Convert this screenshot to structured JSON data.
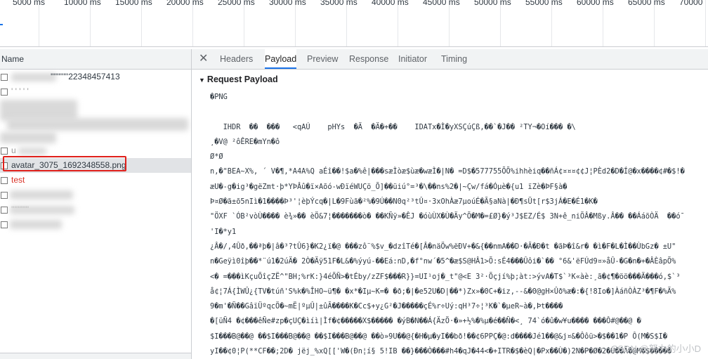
{
  "timeline": {
    "ticks": [
      "5000 ms",
      "10000 ms",
      "15000 ms",
      "20000 ms",
      "25000 ms",
      "30000 ms",
      "35000 ms",
      "40000 ms",
      "45000 ms",
      "50000 ms",
      "55000 ms",
      "60000 ms",
      "65000 ms",
      "70000"
    ]
  },
  "request_list": {
    "header": "Name",
    "items": [
      {
        "label": "'''''''''''22348457413"
      },
      {
        "label": "' ' ' ' '"
      },
      {
        "label": ""
      },
      {
        "label": ""
      },
      {
        "label": "u"
      },
      {
        "label": "avatar_3075_1692348558.png",
        "selected": true
      },
      {
        "label": "test",
        "status": "error"
      },
      {
        "label": ""
      },
      {
        "label": "'''''''''''"
      },
      {
        "label": ""
      }
    ]
  },
  "details": {
    "close_label": "✕",
    "tabs": [
      "Headers",
      "Payload",
      "Preview",
      "Response",
      "Initiator",
      "Timing"
    ],
    "active_tab": "Payload",
    "section_title": "Request Payload",
    "payload_lines": [
      "�PNG",
      "",
      "   IHDR  ��  ���   <qAÚ    pHYs  �Ä  �Ä�+��    IDATx�Ì�yXSÇúÇß,��`�J�� ²TY¬�Oí��� �\\",
      "¸�V@ ²ôÊRE�mYn�ô",
      "Ø*Ø",
      "n,�\"BEA~X%, ´ V�¶,*A4A%Q aÉî��!$a�%ê|���sæÌòæ$ùæ�wæÌ�|N� =D$�577755ÕÕ%ihhèiq��ñÁ¢¤¤¤¢¢J¦PÈd2�D�Í@�x����¢#�$!�",
      "æU�-g�ig³�gëZmt·þ*YÞÂû�ï×Aõó-wÐïéWUÇö_Õ]��üiú°=³�\\��ns%2�|~Çw/fá�Óµè�{u1 ïZè�ÞF§à�",
      "Þ¤Ø�ã±õ5nIì�1����Þ³'¦èþÝcq�|L�9Fùã�²%�9Ú��N0q²³tÛ¤·3xOhÀæ7µoúÉ�Ã§aNà|�Ð¶sÜt[r$3jÁ�E�É1�K�",
      "\"ÖXF `ÓB²vòÙ���� è¾»�� èÖ&7¦�������ò� ��KÑÿ»�ÊJ �óùÙX�Ù�Äy^Õ�M�=£Ø}�ý³J$EZ/É$ 3N+ê_niÕÂ�Mßy.Â�� ��ÁáõÒÄ  ��ó¯",
      "'I�*y1",
      "¿Â�/,4Ûð,��ªþ�|â�³?tÛ6}�K2¿ï�@ ���zô¨%$v_�dzîTé�[Â�näÖw%ëÐV+�&{��nmA��D·�Ã�Ð�t �ãÞ�î&r� �ì�F�L�Ì��ÙbGz� ±U\"",
      "n�Geÿì0îþ��*¨ú1�2úÄ� 2Ò�Äÿ51F�L&�%ýyú-��Eá:nD,�f°nw´�5^�æ$S@HÂ1>Õ:sÉ4���Ûôi�`�� °6&'ëFÚd9¤»åÛ-�G�n�+�ÂÈâpÕ%",
      "<� =���ìKçuÕîçZË^\"BH;%rK:}4éÕÑ>�tÉby/zZF$���R}}=UI¹oj�_t\"@<E 3²·Õçjí%þ;àt:>ývA�T$`³K«àè:¸ã�¢¶�öö���Ä���ó,$`³",
      "å¢¦7Á{ÌWÛ¿{TV�túñ'S%k�%ÎHO~ü¶� �x*�Iµ~K=� �ð;�|�e52U�D|��*)Zx»�0C+�iz,--&�0@gH×Ûð%æ�:�{!8Io�]ÀáñÒÀZ³�¶F�%Ã%",
      "9�m'�Ñ��GâïÜºqcÖ�~mË|ºµÛ|±ûÃ����K�Cc$+y¿G²�J�����çÉ%r÷Uý:qH³7÷¦³K�`�µeR~à�,Þt����",
      "�[üÑ4 �¢���êÑe#zp�çUÇ�ìíì|Ìf�¢�����X$����� �ýB�N��Á{ÄzÖ·�»+½%�%µ�é��Ñ�<¸ 74`ó�û�w¥u���� ���Ô#@��@ �",
      "$I���B@��@ ��$I���B@��@ ��$I���B@��@ ��ò»9U��@{�H�µ�yI��bð!��¢6PPÇ�@:d����Jé1��@&j¤&�Ôôü>�$��1�P Ô(M�S$I�",
      "yI��¢0¦P(**CF��;2D� jëj_%xQ[['W�(Ðn¦í§ 5!IB ��}���Ò���#h4�qJ�44<�+ITR�$�èQ|�Px��Ù�)2N�P�Ø�2�Ù��Ã�@M�$�����"
    ],
    "watermark": "CSDN @努力的小小D"
  }
}
